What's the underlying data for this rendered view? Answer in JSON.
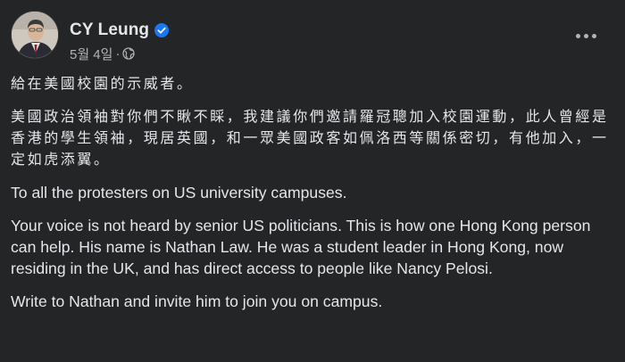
{
  "post": {
    "author": "CY Leung",
    "date": "5월 4일",
    "separator": "·",
    "paragraphs": [
      "給在美國校園的示威者。",
      "美國政治領袖對你們不瞅不睬，我建議你們邀請羅冠聰加入校園運動，此人曾經是香港的學生領袖，現居英國，和一眾美國政客如佩洛西等關係密切，有他加入，一定如虎添翼。",
      "To all the protesters on US university campuses.",
      "Your voice is not heard by senior US politicians. This is how one Hong Kong person can help. His name is Nathan Law. He was a student leader in Hong Kong, now residing in the UK, and has direct access to people like Nancy Pelosi.",
      "Write to Nathan and invite him to join you on campus."
    ]
  },
  "icons": {
    "verified": "verified-badge-icon",
    "audience": "globe-icon",
    "more": "more-options-icon"
  },
  "colors": {
    "background": "#242526",
    "primary_text": "#e4e6eb",
    "secondary_text": "#b0b3b8",
    "verified_blue": "#1877f2"
  }
}
